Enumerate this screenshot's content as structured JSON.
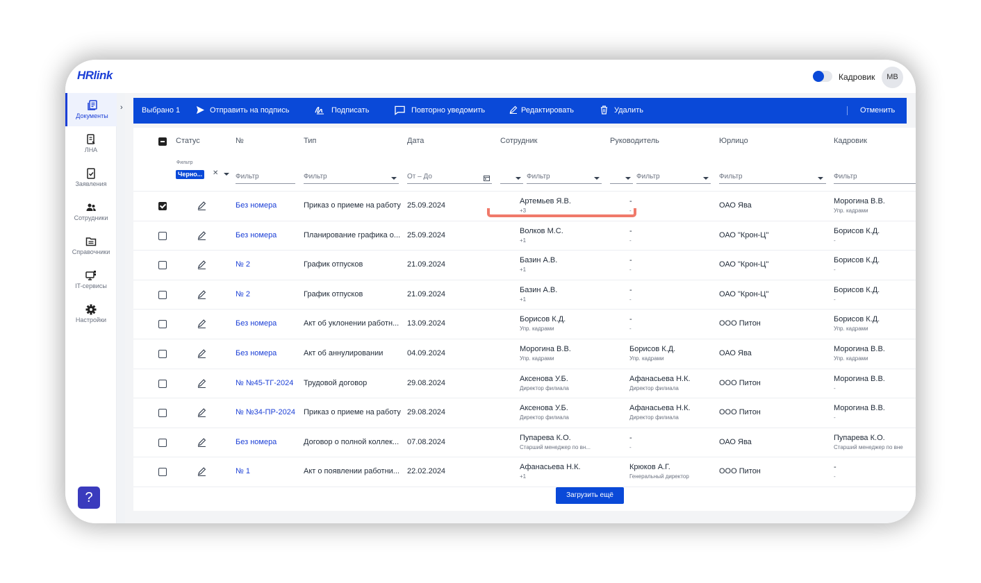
{
  "app": {
    "logo": "HRlink",
    "role_label": "Кадровик",
    "avatar": "МВ"
  },
  "sidebar": {
    "items": [
      {
        "label": "Документы",
        "icon": "documents-icon",
        "active": true
      },
      {
        "label": "ЛНА",
        "icon": "lna-icon"
      },
      {
        "label": "Заявления",
        "icon": "applications-icon"
      },
      {
        "label": "Сотрудники",
        "icon": "employees-icon"
      },
      {
        "label": "Справочники",
        "icon": "folder-icon"
      },
      {
        "label": "IT-сервисы",
        "icon": "monitor-icon"
      },
      {
        "label": "Настройки",
        "icon": "gear-icon"
      }
    ],
    "help": "?"
  },
  "actionbar": {
    "selected": "Выбрано 1",
    "send": "Отправить на подпись",
    "sign": "Подписать",
    "renotify": "Повторно уведомить",
    "edit": "Редактировать",
    "delete": "Удалить",
    "cancel": "Отменить"
  },
  "columns": [
    "Статус",
    "№",
    "Тип",
    "Дата",
    "Сотрудник",
    "Руководитель",
    "Юрлицо",
    "Кадровик"
  ],
  "filters": {
    "status_label": "Фильтр",
    "status_chip": "Черно...",
    "number": "Фильтр",
    "type": "Фильтр",
    "date": "От – До",
    "employee": "Фильтр",
    "manager": "Фильтр",
    "entity": "Фильтр",
    "hr": "Фильтр"
  },
  "rows": [
    {
      "checked": true,
      "number": "Без номера",
      "type": "Приказ о приеме на работу",
      "date": "25.09.2024",
      "employee": "Артемьев Я.В.",
      "employee_sub": "+3",
      "manager": "-",
      "manager_sub": "-",
      "entity": "ОАО Ява",
      "hr": "Морогина В.В.",
      "hr_sub": "Упр. кадрами"
    },
    {
      "checked": false,
      "number": "Без номера",
      "type": "Планирование графика о...",
      "date": "25.09.2024",
      "employee": "Волков М.С.",
      "employee_sub": "+1",
      "manager": "-",
      "manager_sub": "-",
      "entity": "ОАО \"Крон-Ц\"",
      "hr": "Борисов К.Д.",
      "hr_sub": "-"
    },
    {
      "checked": false,
      "number": "№ 2",
      "type": "График отпусков",
      "date": "21.09.2024",
      "employee": "Базин А.В.",
      "employee_sub": "+1",
      "manager": "-",
      "manager_sub": "-",
      "entity": "ОАО \"Крон-Ц\"",
      "hr": "Борисов К.Д.",
      "hr_sub": "-"
    },
    {
      "checked": false,
      "number": "№ 2",
      "type": "График отпусков",
      "date": "21.09.2024",
      "employee": "Базин А.В.",
      "employee_sub": "+1",
      "manager": "-",
      "manager_sub": "-",
      "entity": "ОАО \"Крон-Ц\"",
      "hr": "Борисов К.Д.",
      "hr_sub": "-"
    },
    {
      "checked": false,
      "number": "Без номера",
      "type": "Акт об уклонении работн...",
      "date": "13.09.2024",
      "employee": "Борисов К.Д.",
      "employee_sub": "Упр. кадрами",
      "manager": "-",
      "manager_sub": "-",
      "entity": "ООО Питон",
      "hr": "Борисов К.Д.",
      "hr_sub": "Упр. кадрами"
    },
    {
      "checked": false,
      "number": "Без номера",
      "type": "Акт об аннулировании",
      "date": "04.09.2024",
      "employee": "Морогина В.В.",
      "employee_sub": "Упр. кадрами",
      "manager": "Борисов К.Д.",
      "manager_sub": "Упр. кадрами",
      "entity": "ОАО Ява",
      "hr": "Морогина В.В.",
      "hr_sub": "Упр. кадрами"
    },
    {
      "checked": false,
      "number": "№ №45-ТГ-2024",
      "type": "Трудовой договор",
      "date": "29.08.2024",
      "employee": "Аксенова У.Б.",
      "employee_sub": "Директор филиала",
      "manager": "Афанасьева Н.К.",
      "manager_sub": "Директор филиала",
      "entity": "ООО Питон",
      "hr": "Морогина В.В.",
      "hr_sub": "-"
    },
    {
      "checked": false,
      "number": "№ №34-ПР-2024",
      "type": "Приказ о приеме на работу",
      "date": "29.08.2024",
      "employee": "Аксенова У.Б.",
      "employee_sub": "Директор филиала",
      "manager": "Афанасьева Н.К.",
      "manager_sub": "Директор филиала",
      "entity": "ООО Питон",
      "hr": "Морогина В.В.",
      "hr_sub": "-"
    },
    {
      "checked": false,
      "number": "Без номера",
      "type": "Договор о полной коллек...",
      "date": "07.08.2024",
      "employee": "Пупарева К.О.",
      "employee_sub": "Старший менеджер по вн...",
      "manager": "-",
      "manager_sub": "-",
      "entity": "ОАО Ява",
      "hr": "Пупарева К.О.",
      "hr_sub": "Старший менеджер по вне"
    },
    {
      "checked": false,
      "number": "№ 1",
      "type": "Акт о появлении работни...",
      "date": "22.02.2024",
      "employee": "Афанасьева Н.К.",
      "employee_sub": "+1",
      "manager": "Крюков А.Г.",
      "manager_sub": "Генеральный директор",
      "entity": "ООО Питон",
      "hr": "-",
      "hr_sub": "-"
    }
  ],
  "load_more": "Загрузить ещё",
  "colors": {
    "accent": "#0a49d8",
    "link": "#1b3fd6",
    "highlight": "#f07a6a"
  }
}
